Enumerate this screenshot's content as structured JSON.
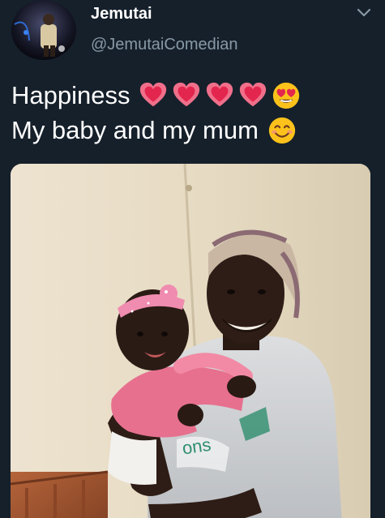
{
  "header": {
    "display_name": "Jemutai",
    "handle": "@JemutaiComedian",
    "avatar_icon": "profile-avatar",
    "menu_icon": "chevron-down-icon"
  },
  "tweet": {
    "line1": "Happiness",
    "line1_emojis": [
      "heart-emoji",
      "heart-emoji",
      "heart-emoji",
      "heart-emoji",
      "heart-eyes-emoji"
    ],
    "line2": "My baby and my mum",
    "line2_emojis": [
      "smiling-face-emoji"
    ]
  },
  "media": {
    "type": "photo",
    "subject": "woman-holding-baby",
    "shirt_print": "ons"
  },
  "colors": {
    "background": "#15202b",
    "text": "#ffffff",
    "secondary_text": "#8899a6"
  }
}
